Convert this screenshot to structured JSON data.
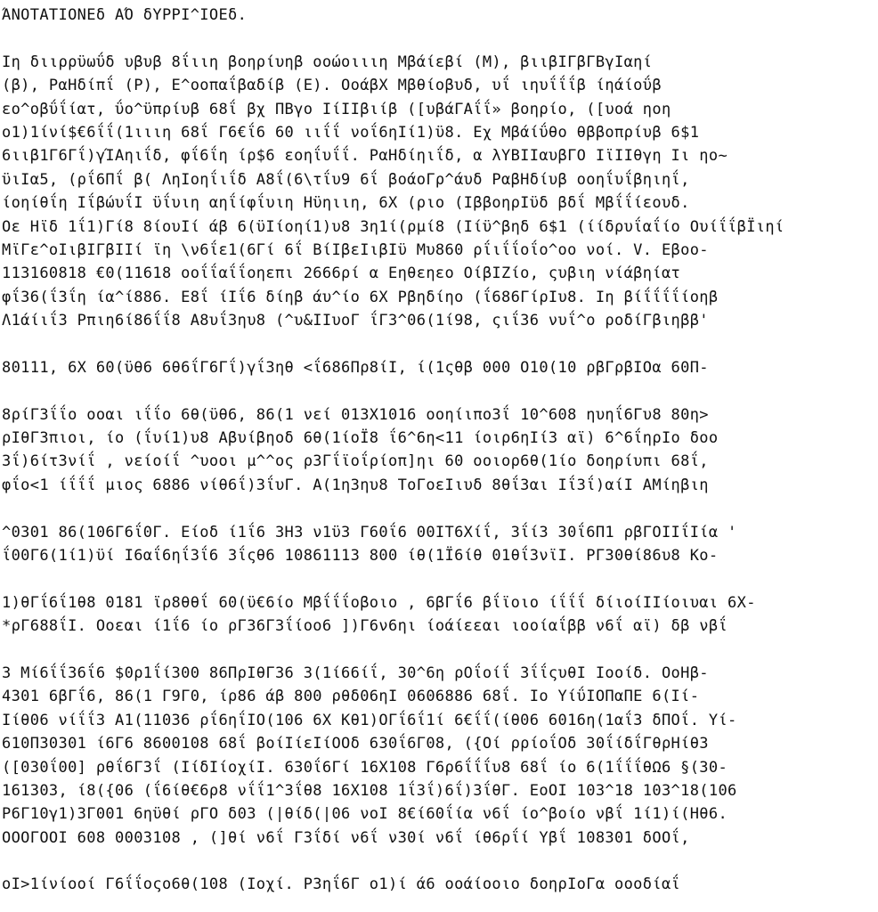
{
  "document": {
    "lines": [
      "ΆΝΟΤΑΤΙΟΝΕδ ΑΌ δΥΡΡΙ^ΙΟΕδ.",
      "",
      "Ιη διιρρϋωΰδ υβυβ 8ΐιιη βοηρίυηβ οοώοιιιη Μβάίεβί (Μ), βιιβΙΓβΓΒγΙαηί",
      "(β), ΡαΗδίπΐ (Ρ), Ε^οοπαΐβαδίβ (Ε). ΟοάβΧ Μβθίοβυδ, υΐ ιηυΐΐΐβ ίηάίοΰβ",
      "εο^οβΰΐίατ, ΰο^ϋπρίυβ 68ΐ βχ ΠΒγο ΙίΙΙβιίβ ([υβάΓΑΐΐ» βοηρίο, ([υοά ηοη",
      "ο1)1ίνί$€6ΐΐ(1ιιιη 68ΐ Γ6€ΐ6 60 ιιΐΐ νοΐ6ηΙί1)ϋ8. Εχ Μβάίΰθο θββοπρίυβ 6$1",
      "6ιιβ1Γ6Γΐ)γΊΑηιΐδ, φΐ6ΐη ίρ$6 εοηΐυΐΐ. ΡαΗδίηιΐδ, α λΥΒΙΙαυβΓΟ ΙϊΙΙθγη Ιι ηο~",
      "ϋιΙα5, (ρΐ6Πΐ β( ΛηΙοηΐιΐδ Α8ΐ(6\\τΐυ9 6ΐ βοάοΓρ^άυδ ΡαβΗδίυβ οοηΐυΐβηιηΐ,",
      "ίοηίθΐη ΙΐβώυΐΙ ϋΐυιη αηΐίφΐυιη Ηϋηιιη, 6Χ (ριο (ΙββοηρΙϋδ βδΐ Μβΐΐίεουδ.",
      "Οε Ηϊδ 1ΐ1)Γί8 8ίουΙί άβ 6(ϋΙίοηί1)υ8 3η1ί(ρμί8 (Ιίϋ^βηδ 6$1 (ίίδρυΐαΐίο ΟυίΐΐβΪιηί",
      "ΜϊΓε^οΙιβΙΓβΙΙί ϊη \\ν6ΐε1(6Γί 6ΐ ΒίΙβεΙιβΙϋ Μυ860 ρΐιΐΐοΐο^οο νοί. V. Εβοο-",
      "113160818 €0(11618 οοΐΐαΐΐοηεπι 2666ρί α Εηθεηεο ΟίβΙΖίο, ςυβιη νίάβηίατ",
      "φΐ36(ΐ3ΐη ία^ί886. Ε8ΐ ίΙΐ6 δίηβ άυ^ίο 6Χ Ρβηδίηο (ΐ686ΓίρΙυ8. Ιη βίΐΐΐΐίοηβ",
      "Λ1άίιΐ3 Ρπιη6ί86ΐΐ8 Α8υΐ3ηυ8 (^υ&ΙΙυοΓ ΐΓ3^06(1ί98, ςιΐ36 νυΐ^ο ροδίΓβιηββ'",
      "",
      "80111, 6Χ 60(ϋθ6 6θ6ΐΓ6Γΐ)γΐ3ηθ <ΐ686Πρ8ίΙ, ί(1ςθβ 000 Ο10(10 ρβΓρβΙΟα 60Π-",
      "",
      "8ρίΓ3ΐΐο οοαι ιΐΐο 6θ(ϋθ6, 86(1 νεί 013Χ1016 οοηίιπο3ΐ 10^608 ηυηΐ6Γυ8 80η>",
      "ρΙθΓ3πιοι, ίο (ΐυί1)υ8 Αβυίβηοδ 6θ(1ίοΪ8 ΐ6^6η<11 ίοιρ6ηΙί3 αϊ) 6^6ΐηρΙο δοο",
      "3ΐ)6ίτ3νίΐ , νείοίΐ ^υοοι μ^^ος ρ3Γΐϊοΐρίοπ]ηι 60 οοιορ6θ(1ίο δοηρίυπι 68ΐ,",
      "φΐο<1 ίΐΐΐ μιος 6886 νίθ6ΐ)3ΐυΓ. Α(1η3ηυ8 ΤοΓοεΙιυδ 8θΐ3αι Ιΐ3ΐ)αίΙ ΑΜίηβιη",
      "",
      "^0301 86(106Γ6ΐ0Γ. Είοδ ί1ΐ6 3Η3 ν1ϋ3 Γ60ΐ6 00ΙΤ6Χίΐ, 3ΐί3 30ΐ6Π1 ρβΓΟΙΙΐΙία '",
      "ΐ00Γ6(1ί1)ϋί Ι6αΐ6ηΐ3ΐ6 3ΐςθ6 10861113 800 ίθ(1Ϊ6ίθ 01θΐ3νϊΙ. ΡΓ30θί86υ8 Κο-",
      "",
      "1)θΓΐ6ΐ1θ8 0181 ϊρ8θθΐ 60(ϋ€6ίο Μβΐΐΐοβοιο , 6βΓΐ6 βΐϊοιο ίΐΐΐ δίιοίΙΙίοιυαι 6Χ-",
      "*ρΓ688ΐΙ. Οοεαι ί1ΐ6 ίο ρΓ36Γ3ΐίοο6 ])Γ6ν6ηι ίοάίεεαι ιοοίαΐββ ν6ΐ αϊ) δβ νβΐ",
      "",
      "3 Μί6ΐΐ36ΐ6 $0ρ1ΐί300 86ΠρΙθΓ36 3(1ί66ίΐ, 30^6η ρΟΐοίΐ 3ΐΐςυθΙ Ιοοίδ. ΟοΗβ-",
      "4301 6βΓΐ6, 86(1 Γ9Γ0, ίρ86 άβ 800 ρθδ06ηΙ 0606886 68ΐ. Ιο ΥίΰΙΟΠαΠΕ 6(Ιί-",
      "Ιίθ06 νίΐΐ3 Α1(11036 ρΐ6ηΐΙΟ(106 6Χ Κθ1)ΟΓΐ6ΐ1ί 6€ΐΐ(ίθ06 6016η(1αΐ3 δΠΟΐ. Υί-",
      "610Π30301 ί6Γ6 8600108 68ΐ βοίΙίεΙίΟΟδ 630ΐ6Γ08, ({Οί ρρίοΐΟδ 30ΐίδΐΓθρΗίθ3",
      "([030ΐ00] ρθΐ6Γ3ΐ (ΙίδΙίοχίΙ. 630ΐ6Γί 16Χ108 Γ6ρ6ΐΐΐυ8 68ΐ ίο 6(1ΐΐΐθΩ6 §(30-",
      "161303, ί8({06 (ΐ6ίθ€6ρ8 νΐΐ1^3ΐθ8 16Χ108 1ΐ3ΐ)6ΐ)3ΐθΓ. ΕοΟΙ 103^18 103^18(106",
      "Ρ6Γ10γ1)3Γ001 6ηϋθί ρΓΟ δ03 (|θίδ(|06 νοΙ 8€ί60ΐία ν6ΐ ίο^βοίο νβΐ 1ί1)ί(Ηθ6.",
      "ΟΟΟΓΟΟΙ 608 0003108 , (]θί ν6ΐ Γ3ΐδί ν6ΐ ν30ί ν6ΐ ίθ6ρΐί Υβΐ 108301 δΟΟΐ,",
      "",
      "οΙ>1ίνίοοί Γ6ΐΐοςο6θ(108 (Ιοχί. Ρ3ηΐ6Γ ο1)ί ά6 οοάίοοιο δοηρΙοΓα οοοδίαΐ"
    ]
  }
}
